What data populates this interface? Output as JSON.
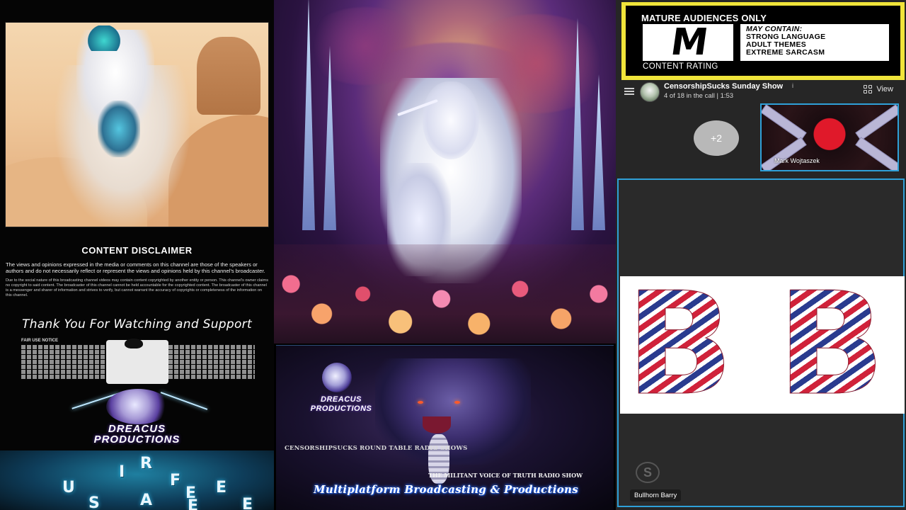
{
  "left_panel": {
    "disclaimer": {
      "title": "CONTENT DISCLAIMER",
      "paragraph1": "The views and opinions expressed in the media or comments on this channel are those of the speakers or authors and do not necessarily reflect or represent the views and opinions held by this channel's broadcaster.",
      "paragraph2": "Due to the social nature of this broadcasting channel videos may contain content copyrighted by another entity or person. This channel's owner claims no copyright to said content. The broadcaster of this channel cannot be held accountable for the copyrighted content. The broadcaster of this channel is a messenger and sharer of information and strives to verify, but cannot warrant the accuracy of copyrights or completeness of the information on this channel."
    },
    "thanks_text": "Thank You For Watching and Support",
    "fair_use_title": "FAIR USE NOTICE",
    "logo": {
      "line1": "DREACUS",
      "line2": "PRODUCTIONS"
    },
    "scramble_letters": [
      "U",
      "S",
      "I",
      "R",
      "A",
      "F",
      "E",
      "E",
      "E",
      "E"
    ]
  },
  "middle_panel": {
    "dragon_logo": {
      "line1": "DREACUS",
      "line2": "PRODUCTIONS"
    },
    "small_caption": "CENSORSHIPSUCKS ROUND TABLE RADIO SHOWS",
    "small_caption2": "THE MILITANT VOICE OF TRUTH RADIO SHOW",
    "banner": "Multiplatform Broadcasting & Productions"
  },
  "rating_card": {
    "title": "MATURE AUDIENCES ONLY",
    "letter": "M",
    "may_contain": "MAY CONTAIN:",
    "items": [
      "STRONG LANGUAGE",
      "ADULT THEMES",
      "EXTREME SARCASM"
    ],
    "footer": "CONTENT RATING"
  },
  "call": {
    "title": "CensorshipSucks Sunday Show",
    "title_info": "i",
    "subtitle": "4 of 18 in the call | 1:53",
    "view_label": "View",
    "more_participants": "+2",
    "participant_tile": {
      "name": "Mark Wojtaszek"
    },
    "main_tile": {
      "letters": [
        "B",
        "B"
      ],
      "name": "Bullhorn Barry"
    }
  },
  "colors": {
    "rating_yellow": "#f0e43a",
    "tile_border": "#2fa0d8",
    "call_bg": "#262626"
  }
}
